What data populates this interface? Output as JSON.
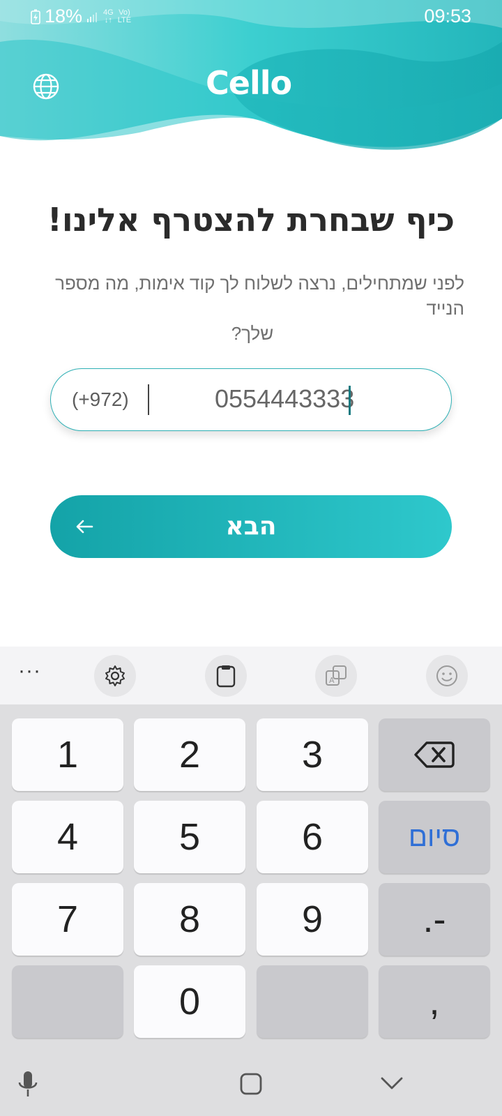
{
  "status_bar": {
    "battery": "18%",
    "network": "4G",
    "volte_line1": "Vo)",
    "volte_line2": "LTE",
    "time": "09:53"
  },
  "header": {
    "logo": "Cello",
    "language_icon": "globe-icon"
  },
  "main": {
    "title": "כיף שבחרת להצטרף אלינו!",
    "subtitle_line1": "לפני שמתחילים, נרצה לשלוח לך קוד אימות, מה מספר הנייד",
    "subtitle_line2": "שלך?",
    "phone": {
      "prefix": "(+972)",
      "value": "0554443333"
    },
    "next_button": {
      "label": "הבא",
      "icon": "arrow-left-icon"
    }
  },
  "keyboard": {
    "toolbar": {
      "more_label": "···",
      "icons": [
        "gear-icon",
        "clipboard-icon",
        "translate-icon",
        "emoji-icon"
      ]
    },
    "keys": {
      "k1": "1",
      "k2": "2",
      "k3": "3",
      "k4": "4",
      "k5": "5",
      "k6": "6",
      "k7": "7",
      "k8": "8",
      "k9": "9",
      "k0": "0",
      "done": "סיום",
      "dot_dash": ".-",
      "comma": ","
    }
  },
  "navbar": {
    "icons": [
      "mic-icon",
      "home-icon",
      "hide-keyboard-icon"
    ]
  },
  "colors": {
    "brand_teal": "#1fb5ba",
    "button_gradient_start": "#14a3a8",
    "button_gradient_end": "#2ec8cc",
    "done_blue": "#2f6fd6"
  }
}
